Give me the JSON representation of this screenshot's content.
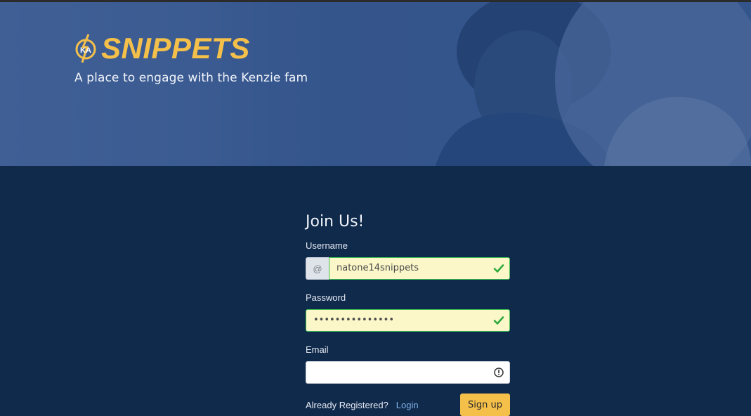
{
  "hero": {
    "logo_text": "SNIPPETS",
    "tagline": "A place to engage with the Kenzie fam"
  },
  "form": {
    "title": "Join Us!",
    "username": {
      "label": "Username",
      "prefix": "@",
      "value": "natone14snippets",
      "status": "valid"
    },
    "password": {
      "label": "Password",
      "value": "•••••••••••••••",
      "status": "valid"
    },
    "email": {
      "label": "Email",
      "value": "",
      "status": "warning"
    },
    "already_registered": "Already Registered?",
    "login_label": "Login",
    "signup_label": "Sign up"
  },
  "colors": {
    "accent": "#f5c04a",
    "background": "#102a4c",
    "valid": "#2eaa3f",
    "valid_fill": "#fbf7c8"
  },
  "icons": {
    "username_status": "check-icon",
    "password_status": "check-icon",
    "email_status": "exclamation-circle-icon"
  }
}
